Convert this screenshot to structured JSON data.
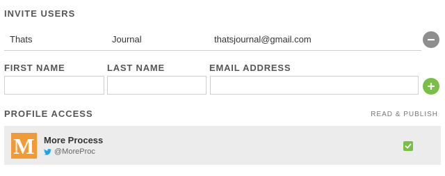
{
  "invite": {
    "title": "INVITE USERS",
    "invited": [
      {
        "first_name": "Thats",
        "last_name": "Journal",
        "email": "thatsjournal@gmail.com"
      }
    ]
  },
  "form": {
    "first_name_label": "FIRST NAME",
    "last_name_label": "LAST NAME",
    "email_label": "EMAIL ADDRESS",
    "first_name_value": "",
    "last_name_value": "",
    "email_value": ""
  },
  "profile_access": {
    "title": "PROFILE ACCESS",
    "permission_label": "READ & PUBLISH",
    "profiles": [
      {
        "avatar_letter": "M",
        "name": "More Process",
        "handle": "@MoreProc",
        "network_icon": "twitter-icon",
        "checked": true
      }
    ]
  },
  "colors": {
    "add_button": "#77c043",
    "remove_button": "#8e8e8e",
    "avatar_bg": "#f29a36",
    "twitter": "#1da1f2"
  }
}
